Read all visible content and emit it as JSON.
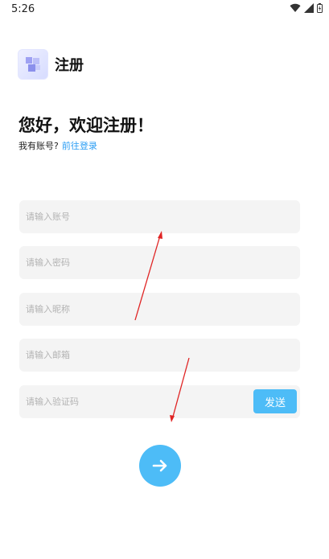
{
  "status_bar": {
    "time": "5:26"
  },
  "header": {
    "title": "注册",
    "logo_icon": "app-logo-icon"
  },
  "greeting": "您好，欢迎注册！",
  "login_prompt": {
    "text": "我有账号?",
    "link": "前往登录"
  },
  "form": {
    "account_placeholder": "请输入账号",
    "password_placeholder": "请输入密码",
    "nickname_placeholder": "请输入昵称",
    "email_placeholder": "请输入邮箱",
    "code_placeholder": "请输入验证码",
    "send_label": "发送",
    "submit_icon": "arrow-right-icon"
  },
  "colors": {
    "accent": "#4dbcf7",
    "link": "#2a9df4",
    "field_bg": "#f4f4f4",
    "annotation": "#e02424"
  }
}
